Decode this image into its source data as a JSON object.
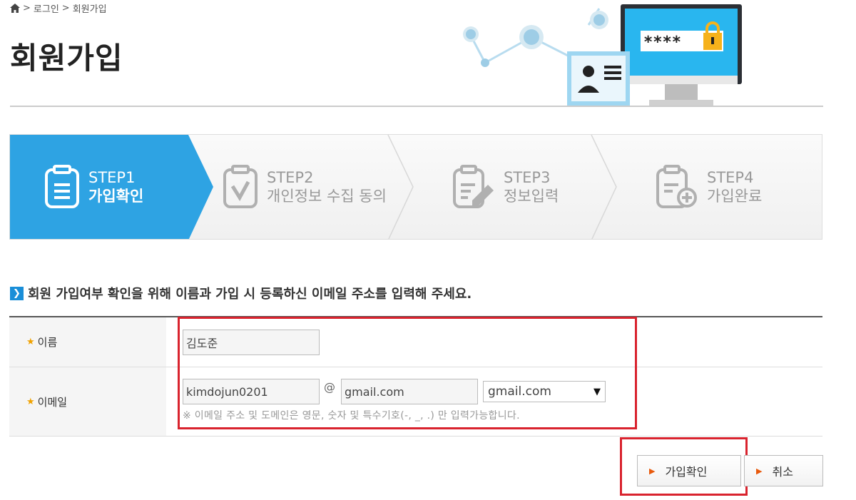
{
  "breadcrumb": {
    "home_icon": "home-icon",
    "sep1": ">",
    "login": "로그인",
    "sep2": ">",
    "current": "회원가입"
  },
  "page_title": "회원가입",
  "hero": {
    "password_mask": "****"
  },
  "steps": [
    {
      "num": "STEP1",
      "label": "가입확인",
      "icon": "clipboard-list-icon",
      "active": true
    },
    {
      "num": "STEP2",
      "label": "개인정보 수집 동의",
      "icon": "clipboard-check-icon",
      "active": false
    },
    {
      "num": "STEP3",
      "label": "정보입력",
      "icon": "clipboard-edit-icon",
      "active": false
    },
    {
      "num": "STEP4",
      "label": "가입완료",
      "icon": "clipboard-plus-icon",
      "active": false
    }
  ],
  "instruction": "회원 가입여부 확인을 위해 이름과 가입 시 등록하신 이메일 주소를 입력해 주세요.",
  "form": {
    "name": {
      "star": "★",
      "label": "이름",
      "value": "김도준"
    },
    "email": {
      "star": "★",
      "label": "이메일",
      "id_value": "kimdojun0201",
      "at": "@",
      "domain_value": "gmail.com",
      "domain_select": "gmail.com",
      "hint": "※ 이메일 주소 및 도메인은 영문, 숫자 및 특수기호(-, _, .) 만 입력가능합니다."
    }
  },
  "buttons": {
    "confirm": "가입확인",
    "cancel": "취소"
  },
  "colors": {
    "active_step": "#2ea3e3",
    "accent": "#1a8ed8",
    "highlight": "#d9232e",
    "button_arrow": "#e8590c"
  }
}
